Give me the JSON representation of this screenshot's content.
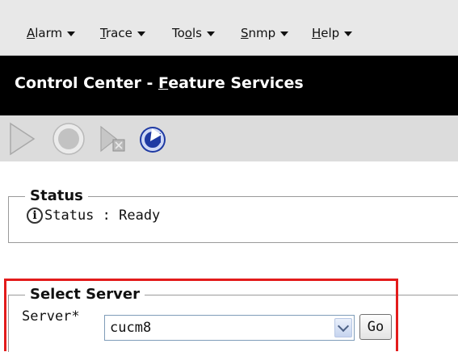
{
  "menu": {
    "items": [
      {
        "pre": "",
        "u": "A",
        "post": "larm"
      },
      {
        "pre": "",
        "u": "T",
        "post": "race"
      },
      {
        "pre": "To",
        "u": "o",
        "post": "ls"
      },
      {
        "pre": "",
        "u": "S",
        "post": "nmp"
      },
      {
        "pre": "",
        "u": "H",
        "post": "elp"
      }
    ]
  },
  "header": {
    "title_prefix": "Control Center - ",
    "title_underlined": "F",
    "title_suffix": "eature Services"
  },
  "toolbar": {
    "buttons": [
      "start-icon",
      "stop-icon",
      "restart-icon",
      "refresh-icon"
    ]
  },
  "status": {
    "legend": "Status",
    "text": "Status : Ready"
  },
  "server": {
    "legend": "Select Server",
    "label": "Server*",
    "selected": "cucm8",
    "go_label": "Go"
  },
  "colors": {
    "title_bar": "#000000",
    "highlight": "#e31b1b",
    "menubar": "#e8e8e8",
    "toolbar": "#dcdcdc"
  }
}
